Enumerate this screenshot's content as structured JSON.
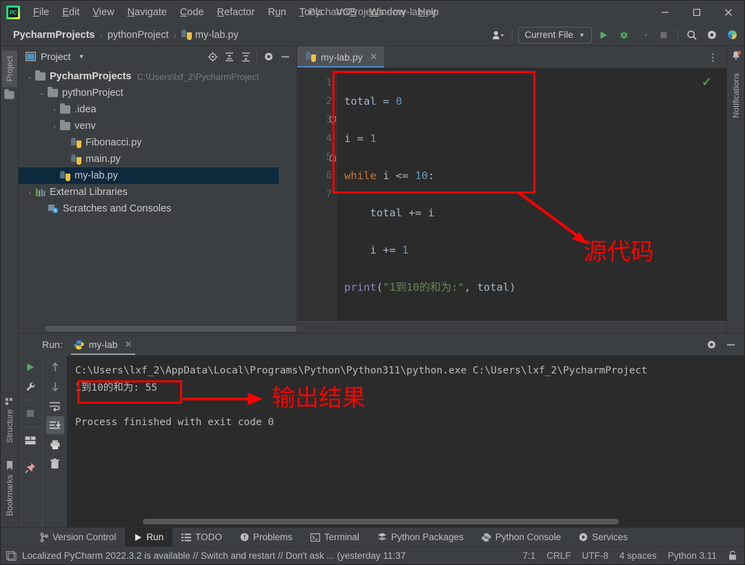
{
  "window": {
    "title": "PycharmProjects - my-lab.py",
    "minimize": "–",
    "maximize": "☐",
    "close": "✕"
  },
  "menu": {
    "items": [
      {
        "pre": "",
        "mn": "F",
        "post": "ile"
      },
      {
        "pre": "",
        "mn": "E",
        "post": "dit"
      },
      {
        "pre": "",
        "mn": "V",
        "post": "iew"
      },
      {
        "pre": "",
        "mn": "N",
        "post": "avigate"
      },
      {
        "pre": "",
        "mn": "C",
        "post": "ode"
      },
      {
        "pre": "",
        "mn": "R",
        "post": "efactor"
      },
      {
        "pre": "R",
        "mn": "u",
        "post": "n"
      },
      {
        "pre": "",
        "mn": "T",
        "post": "ools"
      },
      {
        "pre": "VC",
        "mn": "S",
        "post": ""
      },
      {
        "pre": "",
        "mn": "W",
        "post": "indow"
      },
      {
        "pre": "",
        "mn": "H",
        "post": "elp"
      }
    ]
  },
  "navbar": {
    "breadcrumbs": [
      {
        "label": "PycharmProjects",
        "bold": true,
        "icon": "none"
      },
      {
        "label": "pythonProject",
        "bold": false,
        "icon": "none"
      },
      {
        "label": "my-lab.py",
        "bold": false,
        "icon": "python-file-icon"
      }
    ],
    "separator": "›",
    "run_config": "Current File",
    "run_config_caret": "▼",
    "profile_icon": "user-profile-icon",
    "profile_caret": "▼",
    "run_icon": "run-button",
    "debug_icon": "debug-button",
    "coverage_icon": "run-with-coverage-button",
    "stop_icon": "stop-button",
    "search_icon": "search-everywhere-icon",
    "settings_icon": "settings-gear-icon",
    "updates_icon": "ide-updates-icon"
  },
  "left_strip": {
    "project_tab": "Project",
    "structure_tab": "Structure",
    "bookmarks_tab": "Bookmarks"
  },
  "right_strip": {
    "notifications_tab": "Notifications"
  },
  "project_panel": {
    "title": "Project",
    "title_caret": "▼",
    "tools": [
      "locate-icon",
      "expand-all-icon",
      "collapse-all-icon",
      "gear-icon",
      "hide-icon"
    ],
    "tree": [
      {
        "indent": 0,
        "arrow": "⌄",
        "icon": "folder-icon",
        "name": "PycharmProjects",
        "bold": true,
        "sub": "C:\\Users\\lxf_2\\PycharmProject",
        "selected": false
      },
      {
        "indent": 1,
        "arrow": "⌄",
        "icon": "folder-icon",
        "name": "pythonProject",
        "bold": false,
        "sub": "",
        "selected": false
      },
      {
        "indent": 2,
        "arrow": "›",
        "icon": "folder-icon",
        "name": ".idea",
        "bold": false,
        "sub": "",
        "selected": false
      },
      {
        "indent": 2,
        "arrow": "›",
        "icon": "folder-icon",
        "name": "venv",
        "bold": false,
        "sub": "",
        "selected": false
      },
      {
        "indent": 3,
        "arrow": "",
        "icon": "python-file-icon",
        "name": "Fibonacci.py",
        "bold": false,
        "sub": "",
        "selected": false
      },
      {
        "indent": 3,
        "arrow": "",
        "icon": "python-file-icon",
        "name": "main.py",
        "bold": false,
        "sub": "",
        "selected": false
      },
      {
        "indent": 3,
        "arrow": "",
        "icon": "python-file-icon",
        "name": "my-lab.py",
        "bold": false,
        "sub": "",
        "selected": true
      },
      {
        "indent": 0,
        "arrow": "›",
        "icon": "libraries-icon",
        "name": "External Libraries",
        "bold": false,
        "sub": "",
        "selected": false
      },
      {
        "indent": 1,
        "arrow": "",
        "icon": "scratches-icon",
        "name": "Scratches and Consoles",
        "bold": false,
        "sub": "",
        "selected": false
      }
    ]
  },
  "editor": {
    "tab_label": "my-lab.py",
    "tab_close": "✕",
    "kebab": "⋮",
    "inspection_status": "✓",
    "line_numbers": [
      "1",
      "2",
      "3",
      "4",
      "5",
      "6",
      "7"
    ],
    "lines": [
      {
        "n": 1,
        "tokens": [
          {
            "t": "total ",
            "c": "var"
          },
          {
            "t": "= ",
            "c": "op"
          },
          {
            "t": "0",
            "c": "num"
          }
        ]
      },
      {
        "n": 2,
        "tokens": [
          {
            "t": "i ",
            "c": "var"
          },
          {
            "t": "= ",
            "c": "op"
          },
          {
            "t": "1",
            "c": "num"
          }
        ]
      },
      {
        "n": 3,
        "tokens": [
          {
            "t": "while ",
            "c": "kw"
          },
          {
            "t": "i <= ",
            "c": "var"
          },
          {
            "t": "10",
            "c": "num"
          },
          {
            "t": ":",
            "c": "op"
          }
        ]
      },
      {
        "n": 4,
        "tokens": [
          {
            "t": "    total += i",
            "c": "var"
          }
        ]
      },
      {
        "n": 5,
        "tokens": [
          {
            "t": "    i += ",
            "c": "var"
          },
          {
            "t": "1",
            "c": "num"
          }
        ]
      },
      {
        "n": 6,
        "tokens": [
          {
            "t": "print",
            "c": "fn"
          },
          {
            "t": "(",
            "c": "op"
          },
          {
            "t": "\"1到10的和为:\"",
            "c": "str"
          },
          {
            "t": ", total)",
            "c": "op"
          }
        ]
      },
      {
        "n": 7,
        "tokens": []
      }
    ]
  },
  "run_window": {
    "label": "Run:",
    "tab_name": "my-lab",
    "tab_close": "✕",
    "gear_icon": "settings-gear-icon",
    "hide_icon": "hide-icon",
    "left_tools": [
      "rerun-icon",
      "wrench-icon",
      "stop-icon",
      "layout-icon",
      "pin-icon"
    ],
    "right_tools": [
      "up-arrow-icon",
      "down-arrow-icon",
      "soft-wrap-icon",
      "scroll-to-end-icon",
      "print-icon",
      "trash-icon"
    ],
    "console_lines": [
      "C:\\Users\\lxf_2\\AppData\\Local\\Programs\\Python\\Python311\\python.exe C:\\Users\\lxf_2\\PycharmProject",
      "1到10的和为: 55",
      "",
      "Process finished with exit code 0"
    ]
  },
  "bottom_bar": {
    "items": [
      {
        "label": "Version Control",
        "icon": "branch-icon",
        "active": false
      },
      {
        "label": "Run",
        "icon": "run-icon",
        "active": true
      },
      {
        "label": "TODO",
        "icon": "todo-icon",
        "active": false
      },
      {
        "label": "Problems",
        "icon": "problems-icon",
        "active": false
      },
      {
        "label": "Terminal",
        "icon": "terminal-icon",
        "active": false
      },
      {
        "label": "Python Packages",
        "icon": "packages-icon",
        "active": false
      },
      {
        "label": "Python Console",
        "icon": "python-console-icon",
        "active": false
      },
      {
        "label": "Services",
        "icon": "services-icon",
        "active": false
      }
    ]
  },
  "status_bar": {
    "icon": "event-log-icon",
    "message": "Localized PyCharm 2022.3.2 is available // Switch and restart // Don't ask ... (yesterday 11:37",
    "caret_position": "7:1",
    "line_separator": "CRLF",
    "encoding": "UTF-8",
    "indent": "4 spaces",
    "interpreter": "Python 3.11",
    "lock_icon": "lock-icon"
  },
  "annotations": {
    "source_code_label": "源代码",
    "output_label": "输出结果",
    "color": "#ff0000"
  }
}
